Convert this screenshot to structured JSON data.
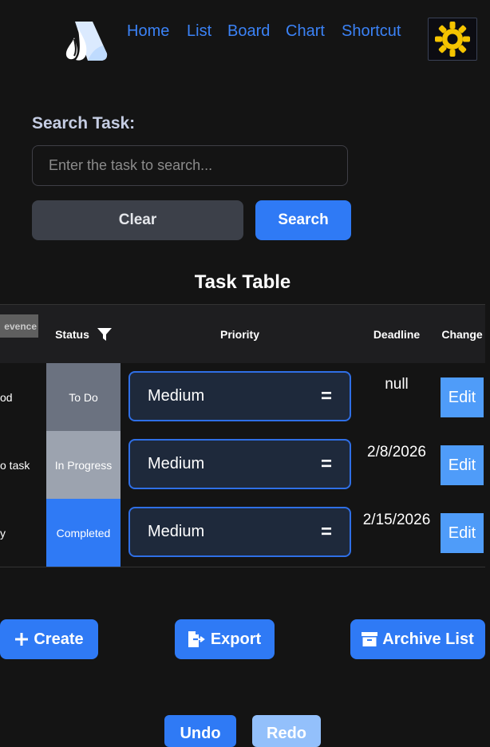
{
  "nav": {
    "links": [
      "Home",
      "List",
      "Board",
      "Chart",
      "Shortcut"
    ],
    "accent_color": "#3b82f6",
    "theme_icon": "sun-icon"
  },
  "search": {
    "label": "Search Task:",
    "placeholder": "Enter the task to search...",
    "value": "",
    "clear_label": "Clear",
    "search_label": "Search"
  },
  "table": {
    "title": "Task Table",
    "prev_column_partial": "evence",
    "headers": {
      "status": "Status",
      "priority": "Priority",
      "deadline": "Deadline",
      "change": "Change"
    },
    "rows": [
      {
        "task": "od",
        "status": "To Do",
        "status_color": "#6b7280",
        "priority": "Medium",
        "deadline": "null",
        "edit": "Edit"
      },
      {
        "task": "o task",
        "status": "In Progress",
        "status_color": "#9ca3af",
        "priority": "Medium",
        "deadline": "2/8/2026",
        "edit": "Edit"
      },
      {
        "task": "y",
        "status": "Completed",
        "status_color": "#2f7af5",
        "priority": "Medium",
        "deadline": "2/15/2026",
        "edit": "Edit"
      }
    ]
  },
  "actions": {
    "create": "Create",
    "export": "Export",
    "archive": "Archive List",
    "undo": "Undo",
    "redo": "Redo"
  }
}
